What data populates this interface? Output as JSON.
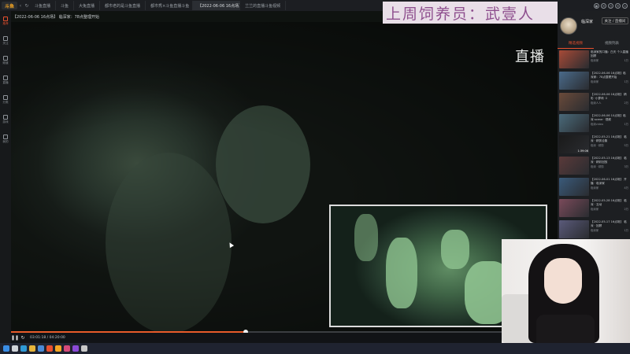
{
  "app": {
    "logo": "斗鱼"
  },
  "tabs": [
    {
      "label": "斗鱼直播"
    },
    {
      "label": "斗鱼"
    },
    {
      "label": "大兔直播"
    },
    {
      "label": "都市老的是斗鱼直播"
    },
    {
      "label": "都市秀×斗鱼直播斗鱼"
    },
    {
      "label": "【2022-06-06 16点场】"
    },
    {
      "label": "兰兰的直播斗鱼视频"
    }
  ],
  "rail": [
    {
      "label": "推荐",
      "icon": "home-icon"
    },
    {
      "label": "关注",
      "icon": "star-icon"
    },
    {
      "label": "频道",
      "icon": "grid-icon"
    },
    {
      "label": "直播",
      "icon": "play-icon"
    },
    {
      "label": "分类",
      "icon": "list-icon"
    },
    {
      "label": "游戏",
      "icon": "gamepad-icon"
    },
    {
      "label": "我的",
      "icon": "user-icon"
    }
  ],
  "video": {
    "title": "【2022-06-06 16点场】 临深家：78点整理开始",
    "live_label": "直播",
    "progress_fraction": 0.43,
    "time": "03:01:18 / 04:20:00"
  },
  "banner": {
    "text": "上周饲养员：武壹人"
  },
  "streamer": {
    "name": "临深家",
    "follow": "关注 / 直播间"
  },
  "panel_tabs": [
    {
      "label": "精选视频",
      "active": true
    },
    {
      "label": "视频列表",
      "active": false
    }
  ],
  "videos": [
    {
      "title": "临深家的口播：白天 个人直播回顾",
      "author": "临深家",
      "views": "1万",
      "dur": "",
      "color": "#a74a37"
    },
    {
      "title": "【2022-06-06 16点场】临深家：78点整理开始",
      "author": "临深家",
      "views": "1万",
      "dur": "",
      "color": "#4a6a8a"
    },
    {
      "title": "【2022-06-06 16点场】 精彩 ·小萝莉 ·2",
      "author": "临深人人",
      "views": "2万",
      "dur": "",
      "color": "#6a4a3a"
    },
    {
      "title": "【2022-06-06 10点场】临深 scene · 视频",
      "author": "临深video",
      "views": "1万",
      "dur": "",
      "color": "#4a6a7a"
    },
    {
      "title": "【2022-05-21 16点场】 临深 · 精剪合集",
      "author": "临深 · 精剪",
      "views": "5万",
      "dur": "1:39:06",
      "color": "#1a1a1a"
    },
    {
      "title": "【2022-05-13 16点场】 临深 · 精彩回放",
      "author": "临深 · 精剪",
      "views": "3万",
      "dur": "",
      "color": "#5a3a3a"
    },
    {
      "title": "【2022-06-01 16点场】 开播 · 临深家",
      "author": "临深家",
      "views": "4万",
      "dur": "",
      "color": "#3a5a7a"
    },
    {
      "title": "【2022-05-28 16点场】 临深 · 互动",
      "author": "临深家",
      "views": "2万",
      "dur": "",
      "color": "#7a4a5a"
    },
    {
      "title": "【2022-05-17 16点场】 临深 · 回顾",
      "author": "临深家",
      "views": "1万",
      "dur": "",
      "color": "#5a5a7a"
    },
    {
      "title": "【2022-05-10 16点场】 临深 · 开场",
      "author": "临深家",
      "views": "2万",
      "dur": "",
      "color": "#3a3a5a"
    }
  ],
  "taskbar_icons": [
    {
      "name": "start-icon",
      "color": "#3a8ee6"
    },
    {
      "name": "search-icon",
      "color": "#cfd3d8"
    },
    {
      "name": "edge-icon",
      "color": "#2f9ad6"
    },
    {
      "name": "folder-icon",
      "color": "#e6b43a"
    },
    {
      "name": "store-icon",
      "color": "#4a8ad6"
    },
    {
      "name": "chrome-icon",
      "color": "#e8502e"
    },
    {
      "name": "douyu-icon",
      "color": "#f5a623"
    },
    {
      "name": "app-icon",
      "color": "#d64a7a"
    },
    {
      "name": "app2-icon",
      "color": "#8a4ad6"
    },
    {
      "name": "app3-icon",
      "color": "#c8c8c8"
    }
  ]
}
